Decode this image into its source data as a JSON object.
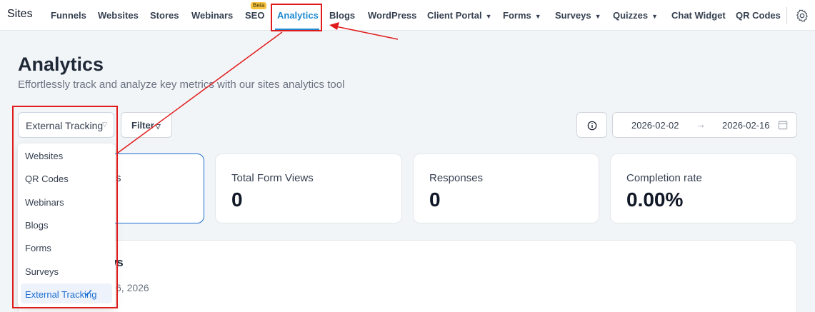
{
  "topnav": {
    "brand": "Sites",
    "items": [
      {
        "label": "Funnels",
        "dropdown": false
      },
      {
        "label": "Websites",
        "dropdown": false
      },
      {
        "label": "Stores",
        "dropdown": false
      },
      {
        "label": "Webinars",
        "dropdown": false
      },
      {
        "label": "SEO",
        "dropdown": false,
        "badge": "Beta"
      },
      {
        "label": "Analytics",
        "dropdown": false,
        "active": true
      },
      {
        "label": "Blogs",
        "dropdown": false
      },
      {
        "label": "WordPress",
        "dropdown": false
      },
      {
        "label": "Client Portal",
        "dropdown": true
      },
      {
        "label": "Forms",
        "dropdown": true
      },
      {
        "label": "Surveys",
        "dropdown": true
      },
      {
        "label": "Quizzes",
        "dropdown": true
      },
      {
        "label": "Chat Widget",
        "dropdown": false
      },
      {
        "label": "QR Codes",
        "dropdown": false
      }
    ],
    "settings_icon": "gear-icon"
  },
  "header": {
    "title": "Analytics",
    "subtitle": "Effortlessly track and analyze key metrics with our sites analytics tool"
  },
  "toolbar": {
    "source_select": {
      "value": "External Tracking"
    },
    "filter_label": "Filter",
    "info_icon": "info-icon",
    "date_range": {
      "start": "2026-02-02",
      "end": "2026-02-16",
      "arrow": "→",
      "icon": "calendar-icon"
    }
  },
  "dropdown": {
    "options": [
      "Websites",
      "QR Codes",
      "Webinars",
      "Blogs",
      "Forms",
      "Surveys",
      "External Tracking"
    ],
    "selected": "External Tracking"
  },
  "metrics": {
    "partial_first_label": "s",
    "cards": [
      {
        "label": "Total Form Views",
        "value": "0"
      },
      {
        "label": "Responses",
        "value": "0"
      },
      {
        "label": "Completion rate",
        "value": "0.00%"
      }
    ]
  },
  "panel": {
    "title_fragment": "ws",
    "date_fragment": "6, 2026"
  },
  "colors": {
    "accent": "#1d8ad1",
    "selected_blue": "#1d6fd1",
    "annotation_red": "#e01b1b",
    "beta_badge": "#f6c343"
  }
}
